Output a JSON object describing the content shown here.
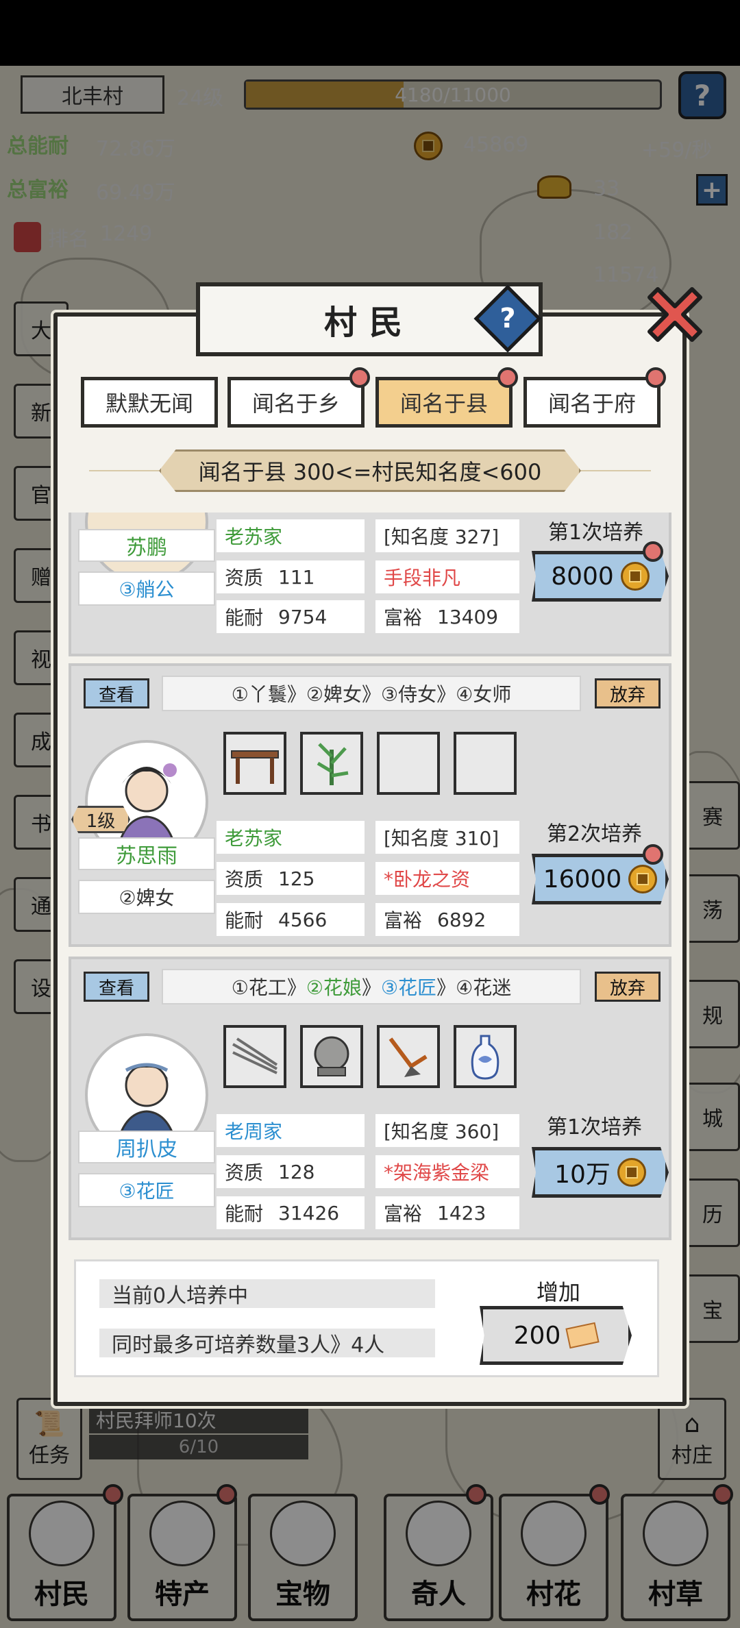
{
  "hud": {
    "village_name": "北丰村",
    "level": "24级",
    "exp": "4180/11000",
    "exp_fraction": 0.38,
    "total_ability_label": "总能耐",
    "total_ability": "72.86万",
    "total_wealth_label": "总富裕",
    "total_wealth": "69.49万",
    "rank_label": "排名",
    "rank": "1249",
    "coins": "45869",
    "coin_rate": "+59/秒",
    "ingots": "33",
    "tickets": "182",
    "other": "11574"
  },
  "popup": {
    "title": "村民",
    "tabs": [
      {
        "label": "默默无闻",
        "active": false,
        "dot": false
      },
      {
        "label": "闻名于乡",
        "active": false,
        "dot": true
      },
      {
        "label": "闻名于县",
        "active": true,
        "dot": true
      },
      {
        "label": "闻名于府",
        "active": false,
        "dot": true
      }
    ],
    "tier_banner": "闻名于县  300<=村民知名度<600",
    "villagers": [
      {
        "name": "苏鹏",
        "rank": "③艄公",
        "family": "老苏家",
        "fame": "[知名度 327]",
        "aptitude_label": "资质",
        "aptitude": "111",
        "talent": "手段非凡",
        "ability_label": "能耐",
        "ability": "9754",
        "wealth_label": "富裕",
        "wealth": "13409",
        "train_label": "第1次培养",
        "cost": "8000"
      },
      {
        "view": "查看",
        "path": [
          "①丫鬟",
          "》",
          "②婢女",
          "》",
          "③侍女",
          "》",
          "④女师"
        ],
        "give_up": "放弃",
        "level": "1级",
        "name": "苏思雨",
        "rank": "②婢女",
        "family": "老苏家",
        "fame": "[知名度 310]",
        "aptitude_label": "资质",
        "aptitude": "125",
        "talent": "*卧龙之资",
        "ability_label": "能耐",
        "ability": "4566",
        "wealth_label": "富裕",
        "wealth": "6892",
        "train_label": "第2次培养",
        "cost": "16000",
        "items": [
          "table-icon",
          "plant-icon",
          "empty",
          "empty"
        ]
      },
      {
        "view": "查看",
        "path": [
          "①花工",
          "》",
          "②花娘",
          "》",
          "③花匠",
          "》",
          "④花迷"
        ],
        "give_up": "放弃",
        "name": "周扒皮",
        "rank": "③花匠",
        "family": "老周家",
        "fame": "[知名度 360]",
        "aptitude_label": "资质",
        "aptitude": "128",
        "talent": "*架海紫金梁",
        "ability_label": "能耐",
        "ability": "31426",
        "wealth_label": "富裕",
        "wealth": "1423",
        "train_label": "第1次培养",
        "cost": "10万",
        "items": [
          "arrows-icon",
          "stone-icon",
          "plow-icon",
          "vase-icon"
        ]
      }
    ],
    "footer": {
      "training_now": "当前0人培养中",
      "max_training": "同时最多可培养数量3人》4人",
      "add_label": "增加",
      "add_cost": "200"
    }
  },
  "left_side": [
    "大",
    "新",
    "官",
    "赠",
    "视",
    "成",
    "书",
    "通",
    "设"
  ],
  "right_side": [
    "赛",
    "荡",
    "规",
    "城",
    "历",
    "宝"
  ],
  "quest": {
    "label": "任务",
    "text": "村民拜师10次",
    "progress": "6/10"
  },
  "village_button": "村庄",
  "nav": [
    "村民",
    "特产",
    "宝物",
    "奇人",
    "村花",
    "村草"
  ]
}
